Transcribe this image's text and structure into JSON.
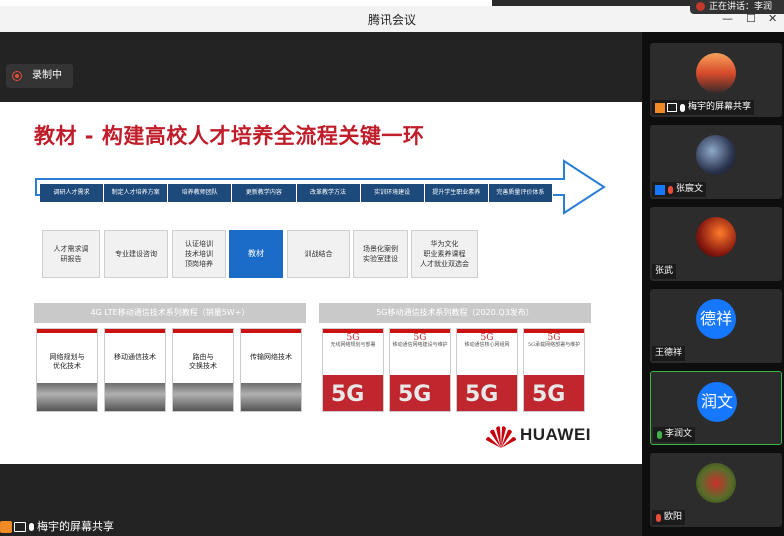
{
  "window": {
    "title": "腾讯会议",
    "speaking": "正在讲话：李润",
    "controls": [
      "—",
      "☐",
      "✕"
    ]
  },
  "recording": {
    "label": "录制中"
  },
  "slide": {
    "title": "教材 - 构建高校人才培养全流程关键一环",
    "steps": [
      "调研人才需求",
      "制定人才培养方案",
      "培养教师团队",
      "更新教学内容",
      "改革教学方法",
      "实训环境建设",
      "提升学生职业素养",
      "完善质量评价体系"
    ],
    "boxes": [
      "人才需求调\n研报告",
      "专业建设咨询",
      "认证培训\n技术培训\n顶岗培养",
      "教材",
      "训战结合",
      "场景化案例\n实验室建设",
      "华为文化\n职业素养课程\n人才就业双选会"
    ],
    "active_box": "教材",
    "series_4g": "4G LTE移动通信技术系列教程（销量5W+）",
    "series_5g": "5G移动通信技术系列教程（2020.Q3发布）",
    "books_4g": [
      "网络规划与\n优化技术",
      "移动通信技术",
      "路由与\n交换技术",
      "传输网络技术"
    ],
    "books_5g": [
      {
        "big": "5G",
        "small": "无线网络规划与部署"
      },
      {
        "big": "5G",
        "small": "移动通信网络建设与维护"
      },
      {
        "big": "5G",
        "small": "移动通信核心网组网"
      },
      {
        "big": "5G",
        "small": "5G承载网络部署与维护"
      }
    ],
    "book_mark": "5G",
    "brand": "HUAWEI",
    "brand_color": "#c7000b"
  },
  "share_status": {
    "label": "梅宇的屏幕共享"
  },
  "participants": [
    {
      "name": "梅宇的屏幕共享",
      "mic": "white",
      "avatar": "sunset",
      "host": true,
      "screen": true
    },
    {
      "name": "张宸文",
      "mic": "red",
      "avatar": "galaxy",
      "host": true
    },
    {
      "name": "张武",
      "mic": "none",
      "avatar": "couple"
    },
    {
      "name": "王德祥",
      "mic": "none",
      "avatar": "text",
      "avatar_text": "德祥"
    },
    {
      "name": "李润文",
      "mic": "green",
      "avatar": "text",
      "avatar_text": "润文",
      "active": true
    },
    {
      "name": "欧阳",
      "mic": "red",
      "avatar": "flowers"
    }
  ]
}
